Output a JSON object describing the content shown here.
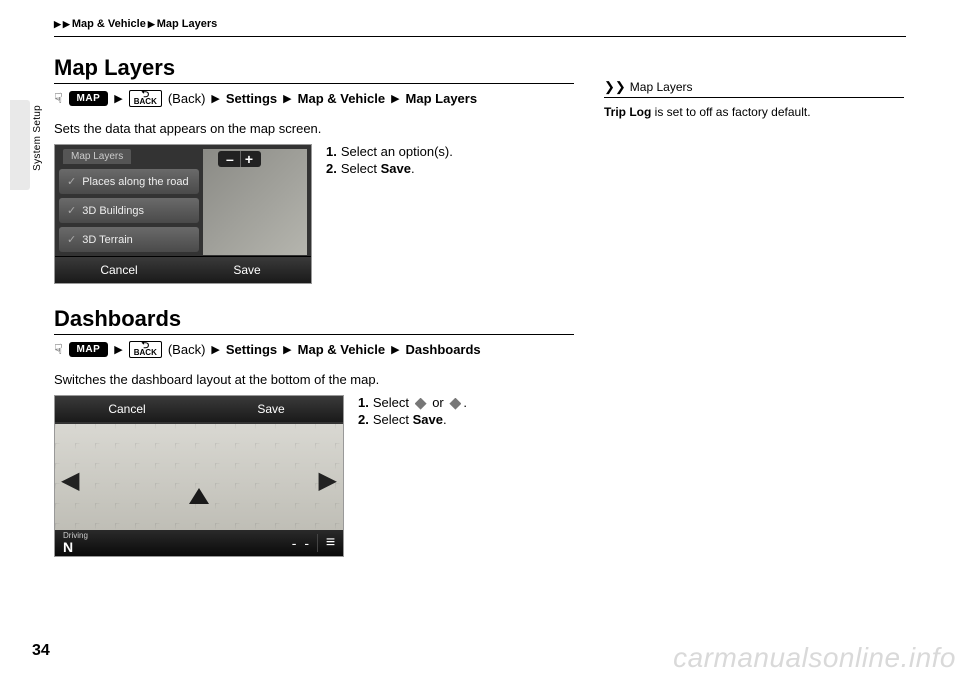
{
  "breadcrumb": {
    "a": "Map & Vehicle",
    "b": "Map Layers"
  },
  "side_label": "System Setup",
  "page_number": "34",
  "watermark": "carmanualsonline.info",
  "s1": {
    "title": "Map Layers",
    "path": {
      "map": "MAP",
      "back_top": "⮌",
      "back_txt": "BACK",
      "back_paren": "(Back)",
      "settings": "Settings",
      "mv": "Map & Vehicle",
      "leaf": "Map Layers"
    },
    "desc": "Sets the data that appears on the map screen.",
    "shot": {
      "tab": "Map Layers",
      "items": [
        "Places along the road",
        "3D Buildings",
        "3D Terrain"
      ],
      "zoom_minus": "–",
      "zoom_plus": "+",
      "cancel": "Cancel",
      "save": "Save"
    },
    "steps": {
      "n1": "1.",
      "t1": "Select an option(s).",
      "n2": "2.",
      "t2a": "Select ",
      "t2b": "Save",
      "t2c": "."
    }
  },
  "s2": {
    "title": "Dashboards",
    "path": {
      "map": "MAP",
      "back_top": "⮌",
      "back_txt": "BACK",
      "back_paren": "(Back)",
      "settings": "Settings",
      "mv": "Map & Vehicle",
      "leaf": "Dashboards"
    },
    "desc": "Switches the dashboard layout at the bottom of the map.",
    "shot": {
      "cancel": "Cancel",
      "save": "Save",
      "driving_lbl": "Driving",
      "driving_val": "N",
      "dashes": "- -",
      "menu": "≡"
    },
    "steps": {
      "n1": "1.",
      "t1a": "Select ",
      "t1b": " or ",
      "t1c": ".",
      "n2": "2.",
      "t2a": "Select ",
      "t2b": "Save",
      "t2c": "."
    }
  },
  "sidebar": {
    "head": "Map Layers",
    "body_b": "Trip Log",
    "body_rest": " is set to off as factory default."
  }
}
